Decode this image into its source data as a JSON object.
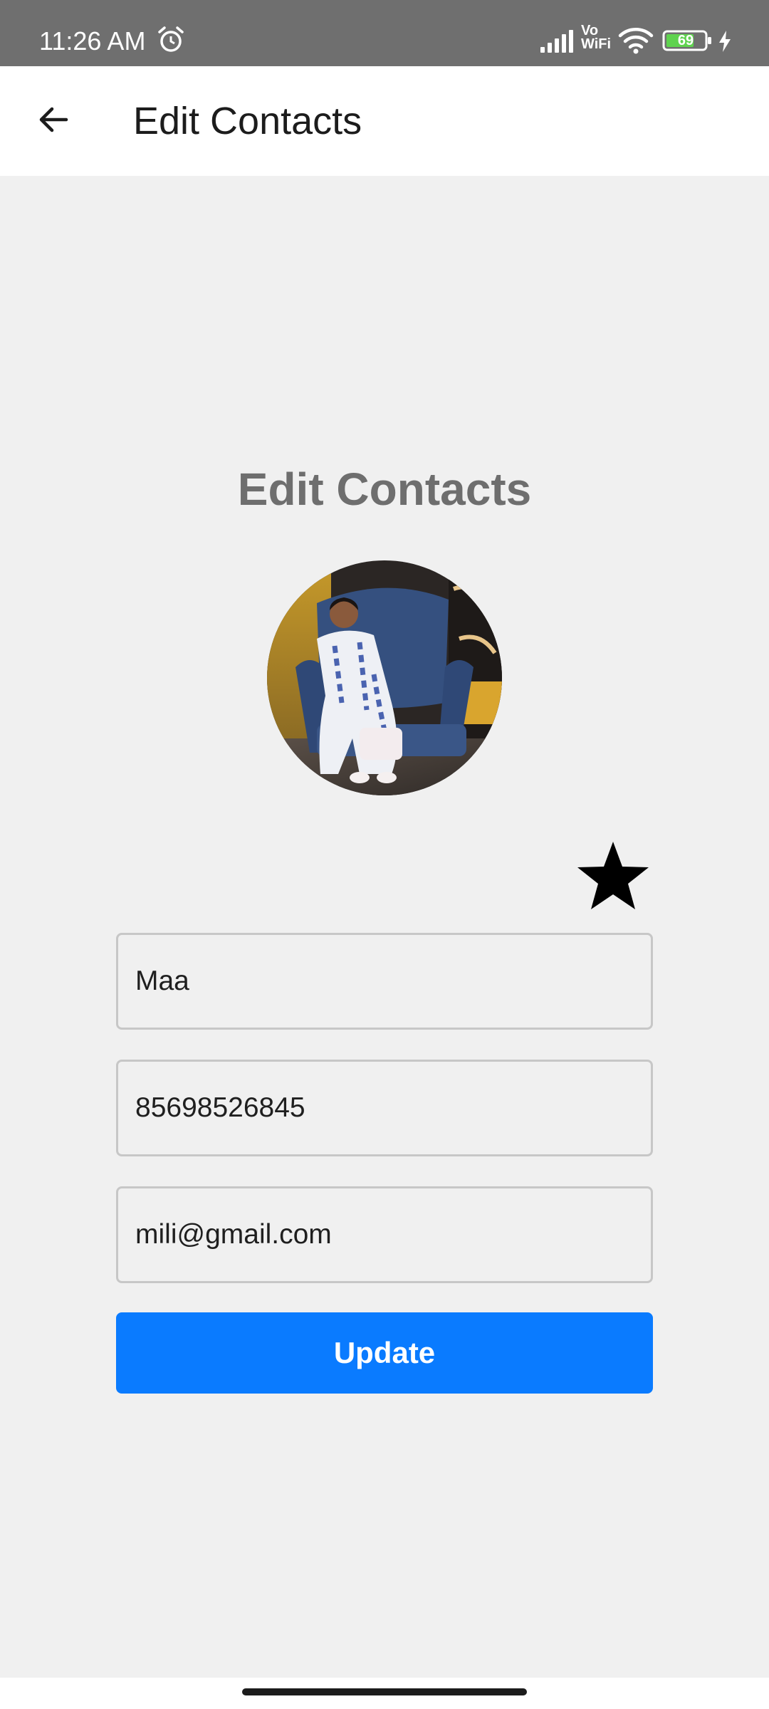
{
  "status_bar": {
    "time": "11:26 AM",
    "alarm_icon": "alarm-clock-icon",
    "network_label": "Vo WiFi",
    "battery_level": "69",
    "icons": [
      "signal-icon",
      "wifi-icon",
      "battery-icon",
      "charging-icon"
    ]
  },
  "app_bar": {
    "back_icon": "arrow-left-icon",
    "title": "Edit Contacts"
  },
  "main": {
    "heading": "Edit Contacts",
    "favorite_icon": "star-icon",
    "name_value": "Maa",
    "phone_value": "85698526845",
    "email_value": "mili@gmail.com",
    "update_label": "Update"
  },
  "colors": {
    "status_bar": "#6f6f6f",
    "background": "#f0f0f0",
    "accent": "#0a7bff",
    "battery_fill": "#5fd34f"
  }
}
